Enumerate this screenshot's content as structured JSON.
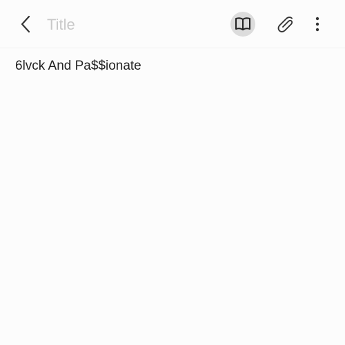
{
  "toolbar": {
    "back_icon": "chevron-left-icon",
    "title_placeholder": "Title",
    "title_value": "",
    "reading_mode_icon": "open-book-icon",
    "attach_icon": "paperclip-icon",
    "more_icon": "more-vertical-icon"
  },
  "note": {
    "body_text": "6lvck And Pa$$ionate"
  },
  "colors": {
    "background": "#fcfcfc",
    "text": "#222222",
    "placeholder": "#c8c8c8",
    "active_button_bg": "#dcdcdc",
    "divider": "#efefef"
  }
}
